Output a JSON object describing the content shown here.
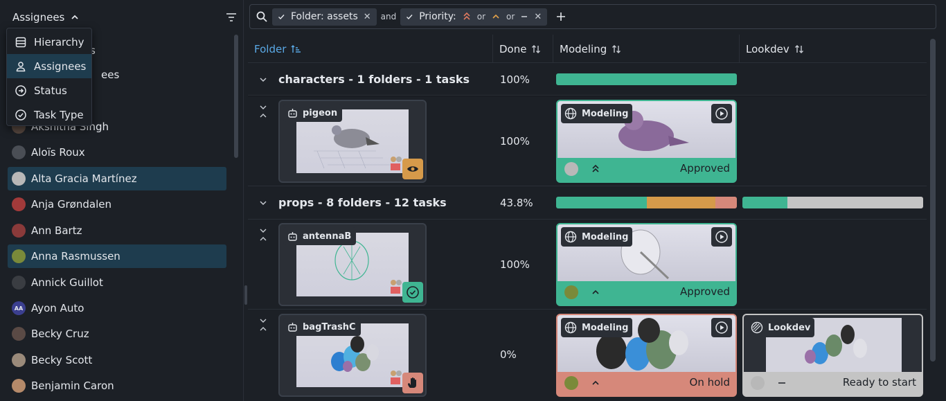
{
  "sidebar": {
    "group_label": "Assignees",
    "group_menu": [
      {
        "label": "Hierarchy",
        "icon": "hierarchy-icon",
        "selected": false
      },
      {
        "label": "Assignees",
        "icon": "person-icon",
        "selected": true
      },
      {
        "label": "Status",
        "icon": "status-icon",
        "selected": false
      },
      {
        "label": "Task Type",
        "icon": "task-type-icon",
        "selected": false
      }
    ],
    "users": [
      {
        "name": "Akshitha Singh",
        "selected": false
      },
      {
        "name": "Aloïs Roux",
        "selected": false
      },
      {
        "name": "Alta Gracia Martínez",
        "selected": true
      },
      {
        "name": "Anja Grøndalen",
        "selected": false
      },
      {
        "name": "Ann Bartz",
        "selected": false
      },
      {
        "name": "Anna Rasmussen",
        "selected": true
      },
      {
        "name": "Annick Guillot",
        "selected": false
      },
      {
        "name": "Ayon Auto",
        "selected": false,
        "initials": "AA"
      },
      {
        "name": "Becky Cruz",
        "selected": false
      },
      {
        "name": "Becky Scott",
        "selected": false
      },
      {
        "name": "Benjamin Caron",
        "selected": false
      }
    ],
    "partial_rows": [
      "s",
      "ees"
    ]
  },
  "filter_bar": {
    "chips": [
      {
        "label": "Folder: assets"
      },
      {
        "label": "Priority:"
      }
    ],
    "conj_and": "and",
    "conj_or": "or"
  },
  "table": {
    "columns": {
      "folder": "Folder",
      "done": "Done",
      "modeling": "Modeling",
      "lookdev": "Lookdev"
    },
    "groups": [
      {
        "title": "characters - 1 folders - 1 tasks",
        "done": "100%"
      },
      {
        "title": "props - 8 folders - 12 tasks",
        "done": "43.8%"
      }
    ],
    "rows": [
      {
        "folder": "pigeon",
        "done": "100%",
        "modeling_type": "Modeling",
        "modeling_status": "Approved"
      },
      {
        "folder": "antennaB",
        "done": "100%",
        "modeling_type": "Modeling",
        "modeling_status": "Approved"
      },
      {
        "folder": "bagTrashC",
        "done": "0%",
        "modeling_type": "Modeling",
        "modeling_status": "On hold",
        "lookdev_type": "Lookdev",
        "lookdev_status": "Ready to start"
      }
    ]
  },
  "colors": {
    "approved": "#3fb592",
    "on_hold": "#d6887a",
    "ready": "#c4c4c4",
    "in_review": "#d69a4a",
    "accent": "#5aa9e6"
  }
}
